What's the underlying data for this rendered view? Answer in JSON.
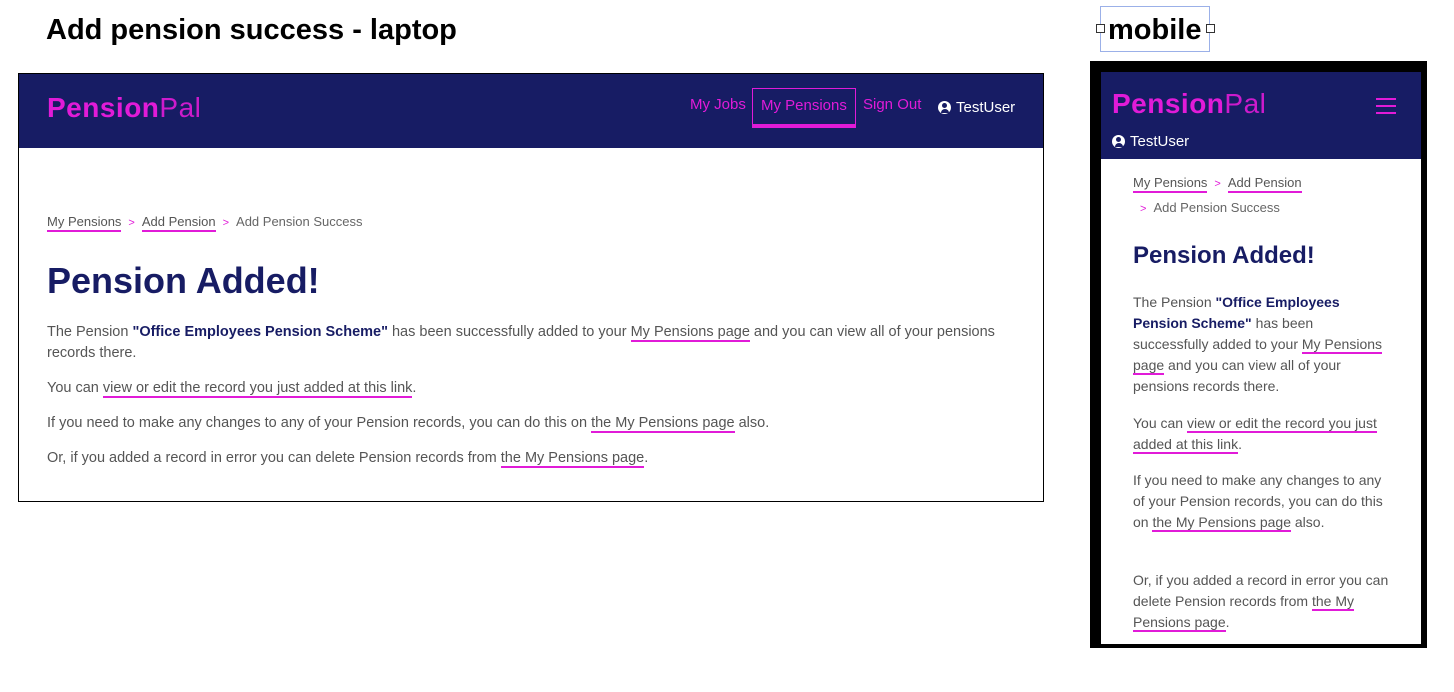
{
  "titles": {
    "laptop": "Add pension success - laptop",
    "mobile": "mobile"
  },
  "brand": {
    "bold": "Pension",
    "light": "Pal"
  },
  "nav": {
    "jobs": "My Jobs",
    "pensions": "My Pensions",
    "signout": "Sign Out",
    "user": "TestUser"
  },
  "breadcrumb": {
    "items": [
      "My Pensions",
      "Add Pension",
      "Add Pension Success"
    ],
    "separator": ">"
  },
  "heading": "Pension Added!",
  "content": {
    "p1_pre": "The Pension ",
    "p1_bold": "\"Office Employees Pension Scheme\"",
    "p1_mid": " has been successfully added to your ",
    "p1_link": "My Pensions page",
    "p1_post": " and you can view all of your pensions records there.",
    "p2_pre": "You can ",
    "p2_link": "view or edit the record you just added at this link",
    "p2_post": ".",
    "p3_pre": "If you need to make any changes to any of your Pension records, you can do this on ",
    "p3_link": "the My Pensions page",
    "p3_post": " also.",
    "p4_pre": "Or, if you added a record in error you can delete Pension records from ",
    "p4_link": "the My Pensions page",
    "p4_post": "."
  },
  "colors": {
    "navy": "#171c64",
    "accent": "#e11bd8"
  },
  "icons": {
    "user": "user-circle-icon",
    "menu": "hamburger-menu-icon"
  }
}
